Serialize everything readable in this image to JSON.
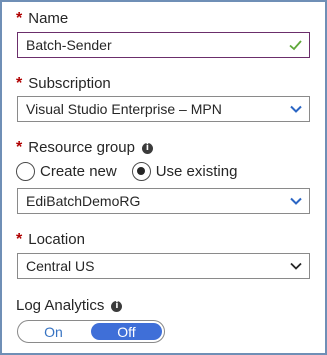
{
  "name": {
    "label": "Name",
    "required_mark": "*",
    "value": "Batch-Sender"
  },
  "subscription": {
    "label": "Subscription",
    "required_mark": "*",
    "value": "Visual Studio Enterprise – MPN"
  },
  "resource_group": {
    "label": "Resource group",
    "required_mark": "*",
    "info_icon": "i",
    "options": [
      "Create new",
      "Use existing"
    ],
    "selected_option": "Use existing",
    "value": "EdiBatchDemoRG"
  },
  "location": {
    "label": "Location",
    "required_mark": "*",
    "value": "Central US"
  },
  "log_analytics": {
    "label": "Log Analytics",
    "info_icon": "i",
    "toggle_on": "On",
    "toggle_off": "Off",
    "selected": "Off"
  },
  "colors": {
    "required": "#b00000",
    "chevron": "#2b66c4",
    "check": "#5fa83a",
    "toggle_selected": "#3f6fd8"
  }
}
